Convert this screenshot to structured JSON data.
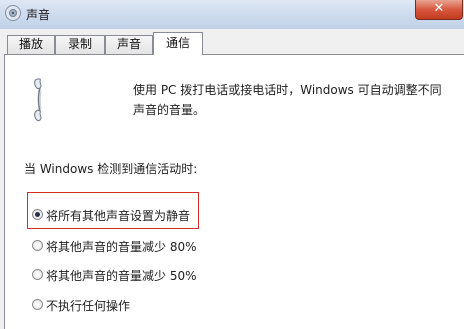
{
  "window": {
    "title": "声音",
    "close_label": "✕",
    "accent": "#d7573e"
  },
  "tabs": [
    {
      "label": "播放",
      "active": false
    },
    {
      "label": "录制",
      "active": false
    },
    {
      "label": "声音",
      "active": false
    },
    {
      "label": "通信",
      "active": true
    }
  ],
  "communications": {
    "icon": "phone-handset-icon",
    "description_line1": "使用 PC 拨打电话或接电话时，Windows 可自动调整不同",
    "description_line2": "声音的音量。",
    "when_label": "当 Windows 检测到通信活动时:",
    "options": [
      {
        "label": "将所有其他声音设置为静音",
        "selected": true
      },
      {
        "label": "将其他声音的音量减少 80%",
        "selected": false
      },
      {
        "label": "将其他声音的音量减少 50%",
        "selected": false
      },
      {
        "label": "不执行任何操作",
        "selected": false
      }
    ]
  }
}
